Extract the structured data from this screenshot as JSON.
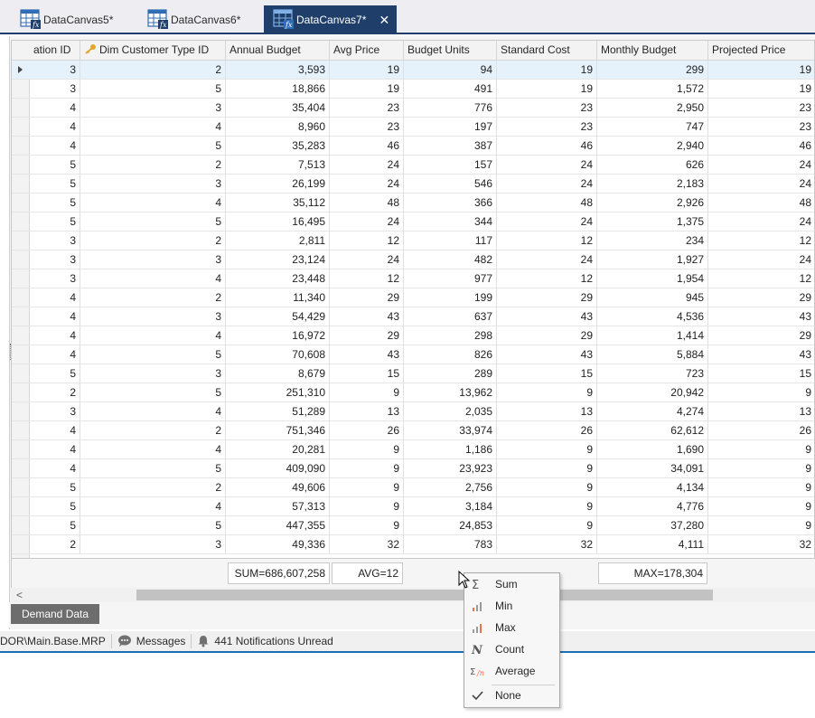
{
  "tabs": [
    {
      "label": "DataCanvas5*",
      "active": false
    },
    {
      "label": "DataCanvas6*",
      "active": false
    },
    {
      "label": "DataCanvas7*",
      "active": true,
      "close": "✕"
    }
  ],
  "grid": {
    "columns": [
      "ation ID",
      "Dim Customer Type ID",
      "Annual Budget",
      "Avg Price",
      "Budget Units",
      "Standard Cost",
      "Monthly Budget",
      "Projected Price"
    ],
    "rows": [
      [
        "3",
        "2",
        "3,593",
        "19",
        "94",
        "19",
        "299",
        "19"
      ],
      [
        "3",
        "5",
        "18,866",
        "19",
        "491",
        "19",
        "1,572",
        "19"
      ],
      [
        "4",
        "3",
        "35,404",
        "23",
        "776",
        "23",
        "2,950",
        "23"
      ],
      [
        "4",
        "4",
        "8,960",
        "23",
        "197",
        "23",
        "747",
        "23"
      ],
      [
        "4",
        "5",
        "35,283",
        "46",
        "387",
        "46",
        "2,940",
        "46"
      ],
      [
        "5",
        "2",
        "7,513",
        "24",
        "157",
        "24",
        "626",
        "24"
      ],
      [
        "5",
        "3",
        "26,199",
        "24",
        "546",
        "24",
        "2,183",
        "24"
      ],
      [
        "5",
        "4",
        "35,112",
        "48",
        "366",
        "48",
        "2,926",
        "48"
      ],
      [
        "5",
        "5",
        "16,495",
        "24",
        "344",
        "24",
        "1,375",
        "24"
      ],
      [
        "3",
        "2",
        "2,811",
        "12",
        "117",
        "12",
        "234",
        "12"
      ],
      [
        "3",
        "3",
        "23,124",
        "24",
        "482",
        "24",
        "1,927",
        "24"
      ],
      [
        "3",
        "4",
        "23,448",
        "12",
        "977",
        "12",
        "1,954",
        "12"
      ],
      [
        "4",
        "2",
        "11,340",
        "29",
        "199",
        "29",
        "945",
        "29"
      ],
      [
        "4",
        "3",
        "54,429",
        "43",
        "637",
        "43",
        "4,536",
        "43"
      ],
      [
        "4",
        "4",
        "16,972",
        "29",
        "298",
        "29",
        "1,414",
        "29"
      ],
      [
        "4",
        "5",
        "70,608",
        "43",
        "826",
        "43",
        "5,884",
        "43"
      ],
      [
        "5",
        "3",
        "8,679",
        "15",
        "289",
        "15",
        "723",
        "15"
      ],
      [
        "2",
        "5",
        "251,310",
        "9",
        "13,962",
        "9",
        "20,942",
        "9"
      ],
      [
        "3",
        "4",
        "51,289",
        "13",
        "2,035",
        "13",
        "4,274",
        "13"
      ],
      [
        "4",
        "2",
        "751,346",
        "26",
        "33,974",
        "26",
        "62,612",
        "26"
      ],
      [
        "4",
        "4",
        "20,281",
        "9",
        "1,186",
        "9",
        "1,690",
        "9"
      ],
      [
        "4",
        "5",
        "409,090",
        "9",
        "23,923",
        "9",
        "34,091",
        "9"
      ],
      [
        "5",
        "2",
        "49,606",
        "9",
        "2,756",
        "9",
        "4,134",
        "9"
      ],
      [
        "5",
        "4",
        "57,313",
        "9",
        "3,184",
        "9",
        "4,776",
        "9"
      ],
      [
        "5",
        "5",
        "447,355",
        "9",
        "24,853",
        "9",
        "37,280",
        "9"
      ],
      [
        "2",
        "3",
        "49,336",
        "32",
        "783",
        "32",
        "4,111",
        "32"
      ]
    ]
  },
  "summary": {
    "sum": "SUM=686,607,258",
    "avg": "AVG=12",
    "max": "MAX=178,304"
  },
  "scrollbar": {
    "left_arrow": "<"
  },
  "sheet_tab": "Demand Data",
  "status": {
    "path": "DOR\\Main.Base.MRP",
    "messages": "Messages",
    "notifications": "441 Notifications Unread"
  },
  "context_menu": {
    "items": [
      {
        "label": "Sum",
        "icon": "sigma-icon"
      },
      {
        "label": "Min",
        "icon": "bar-min-icon"
      },
      {
        "label": "Max",
        "icon": "bar-max-icon"
      },
      {
        "label": "Count",
        "icon": "count-n-icon"
      },
      {
        "label": "Average",
        "icon": "average-icon"
      },
      {
        "label": "None",
        "icon": "check-icon"
      }
    ]
  },
  "colors": {
    "accent": "#1f3f6a",
    "status_line": "#1f6fb5",
    "selected_row": "#e5f1fb",
    "bar_orange": "#e8734a"
  }
}
